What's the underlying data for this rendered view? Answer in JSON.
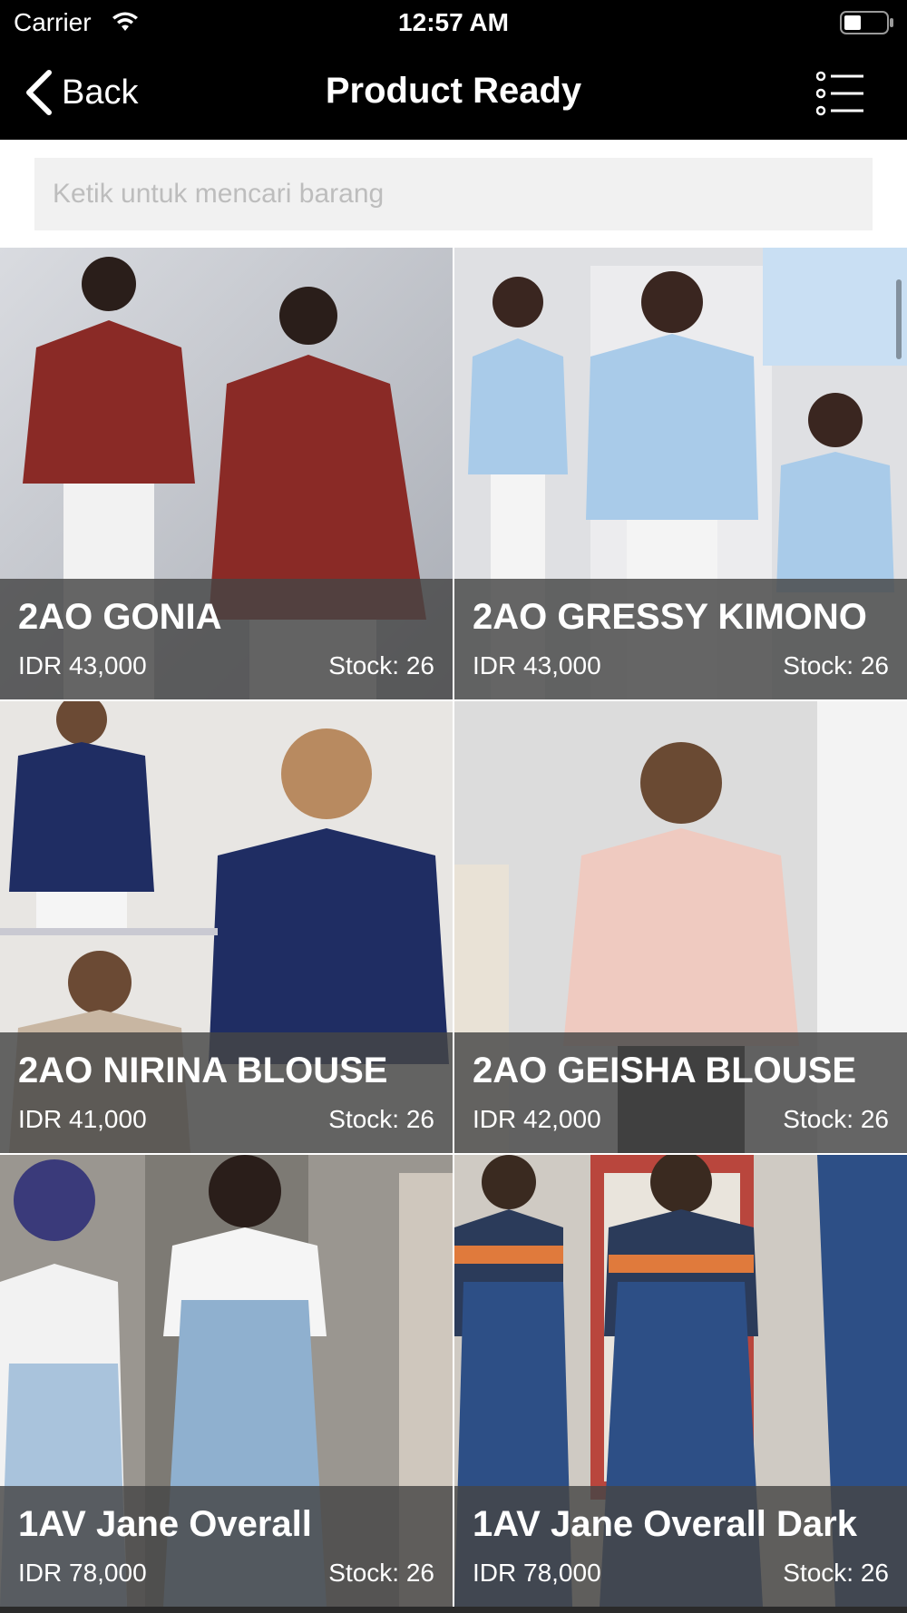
{
  "status_bar": {
    "carrier": "Carrier",
    "time": "12:57 AM",
    "wifi_icon": "wifi-icon",
    "battery_icon": "battery-icon"
  },
  "nav": {
    "back_label": "Back",
    "title": "Product Ready",
    "back_icon": "chevron-left-icon",
    "menu_icon": "list-menu-icon"
  },
  "search": {
    "value": "",
    "placeholder": "Ketik untuk mencari barang"
  },
  "products": [
    {
      "name": "2AO GONIA",
      "price": "IDR 43,000",
      "stock": "Stock: 26",
      "color": "#8a2a26"
    },
    {
      "name": "2AO GRESSY KIMONO",
      "price": "IDR 43,000",
      "stock": "Stock: 26",
      "color": "#a9cbe9"
    },
    {
      "name": "2AO NIRINA BLOUSE",
      "price": "IDR 41,000",
      "stock": "Stock: 26",
      "color": "#1f2d63"
    },
    {
      "name": "2AO GEISHA BLOUSE",
      "price": "IDR 42,000",
      "stock": "Stock: 26",
      "color": "#efcac0"
    },
    {
      "name": "1AV Jane Overall",
      "price": "IDR 78,000",
      "stock": "Stock: 26",
      "color": "#8fb0cf"
    },
    {
      "name": "1AV Jane Overall Dark",
      "price": "IDR 78,000",
      "stock": "Stock: 26",
      "color": "#2d4f86"
    }
  ]
}
